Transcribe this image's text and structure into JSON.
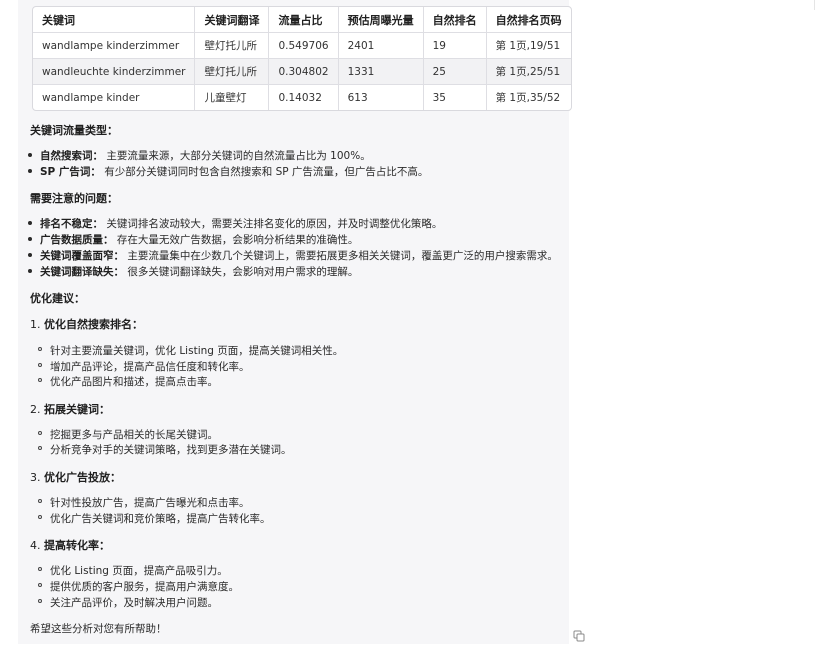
{
  "table": {
    "headers": [
      "关键词",
      "关键词翻译",
      "流量占比",
      "预估周曝光量",
      "自然排名",
      "自然排名页码"
    ],
    "rows": [
      [
        "wandlampe kinderzimmer",
        "壁灯托儿所",
        "0.549706",
        "2401",
        "19",
        "第 1页,19/51"
      ],
      [
        "wandleuchte kinderzimmer",
        "壁灯托儿所",
        "0.304802",
        "1331",
        "25",
        "第 1页,25/51"
      ],
      [
        "wandlampe kinder",
        "儿童壁灯",
        "0.14032",
        "613",
        "35",
        "第 1页,35/52"
      ]
    ]
  },
  "traffic_types": {
    "heading": "关键词流量类型：",
    "items": [
      {
        "term": "自然搜索词：",
        "text": "主要流量来源，大部分关键词的自然流量占比为 100%。"
      },
      {
        "term": "SP 广告词：",
        "text": "有少部分关键词同时包含自然搜索和 SP 广告流量，但广告占比不高。"
      }
    ]
  },
  "issues": {
    "heading": "需要注意的问题：",
    "items": [
      {
        "term": "排名不稳定：",
        "text": "关键词排名波动较大，需要关注排名变化的原因，并及时调整优化策略。"
      },
      {
        "term": "广告数据质量：",
        "text": "存在大量无效广告数据，会影响分析结果的准确性。"
      },
      {
        "term": "关键词覆盖面窄：",
        "text": "主要流量集中在少数几个关键词上，需要拓展更多相关关键词，覆盖更广泛的用户搜索需求。"
      },
      {
        "term": "关键词翻译缺失：",
        "text": "很多关键词翻译缺失，会影响对用户需求的理解。"
      }
    ]
  },
  "suggestions": {
    "heading": "优化建议：",
    "groups": [
      {
        "num": "1.",
        "title": "优化自然搜索排名：",
        "items": [
          "针对主要流量关键词，优化 Listing 页面，提高关键词相关性。",
          "增加产品评论，提高产品信任度和转化率。",
          "优化产品图片和描述，提高点击率。"
        ]
      },
      {
        "num": "2.",
        "title": "拓展关键词：",
        "items": [
          "挖掘更多与产品相关的长尾关键词。",
          "分析竞争对手的关键词策略，找到更多潜在关键词。"
        ]
      },
      {
        "num": "3.",
        "title": "优化广告投放：",
        "items": [
          "针对性投放广告，提高广告曝光和点击率。",
          "优化广告关键词和竞价策略，提高广告转化率。"
        ]
      },
      {
        "num": "4.",
        "title": "提高转化率：",
        "items": [
          "优化 Listing 页面，提高产品吸引力。",
          "提供优质的客户服务，提高用户满意度。",
          "关注产品评价，及时解决用户问题。"
        ]
      }
    ]
  },
  "closing": "希望这些分析对您有所帮助！",
  "icons": {
    "copy": "copy-icon"
  }
}
